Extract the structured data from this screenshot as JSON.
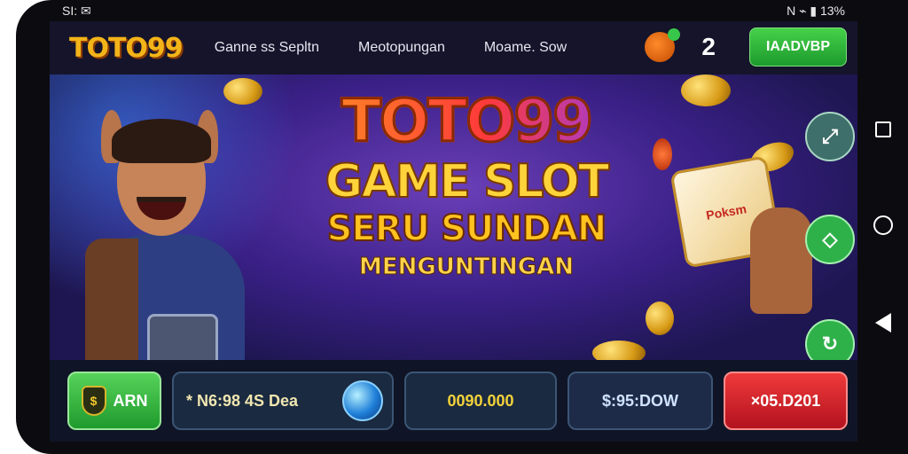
{
  "status_bar": {
    "left": "SI: ✉",
    "right": "N  ⌁  ▮ 13%"
  },
  "header": {
    "logo": "TOTO99",
    "nav": [
      "Ganne ss Sepltn",
      "Meotopungan",
      "Moame. Sow"
    ],
    "badge_number": "2",
    "top_button": "IAADVBP"
  },
  "banner": {
    "title_line1": "TOTO99",
    "title_line2": "GAME SLOT",
    "title_line3": "SERU SUNDAN",
    "title_line4": "MENGUNTINGAN",
    "slot_box_text": "Poksm"
  },
  "bottom_bar": {
    "green_label": "ARN",
    "promo_text": "* N6:98 4S Dea",
    "amount1": "0090.000",
    "amount2": "$:95:DOW",
    "red_button": "×05.D201"
  },
  "colors": {
    "accent_green": "#2fb14a",
    "accent_red": "#d91f2a",
    "gold": "#ffcf2e"
  }
}
